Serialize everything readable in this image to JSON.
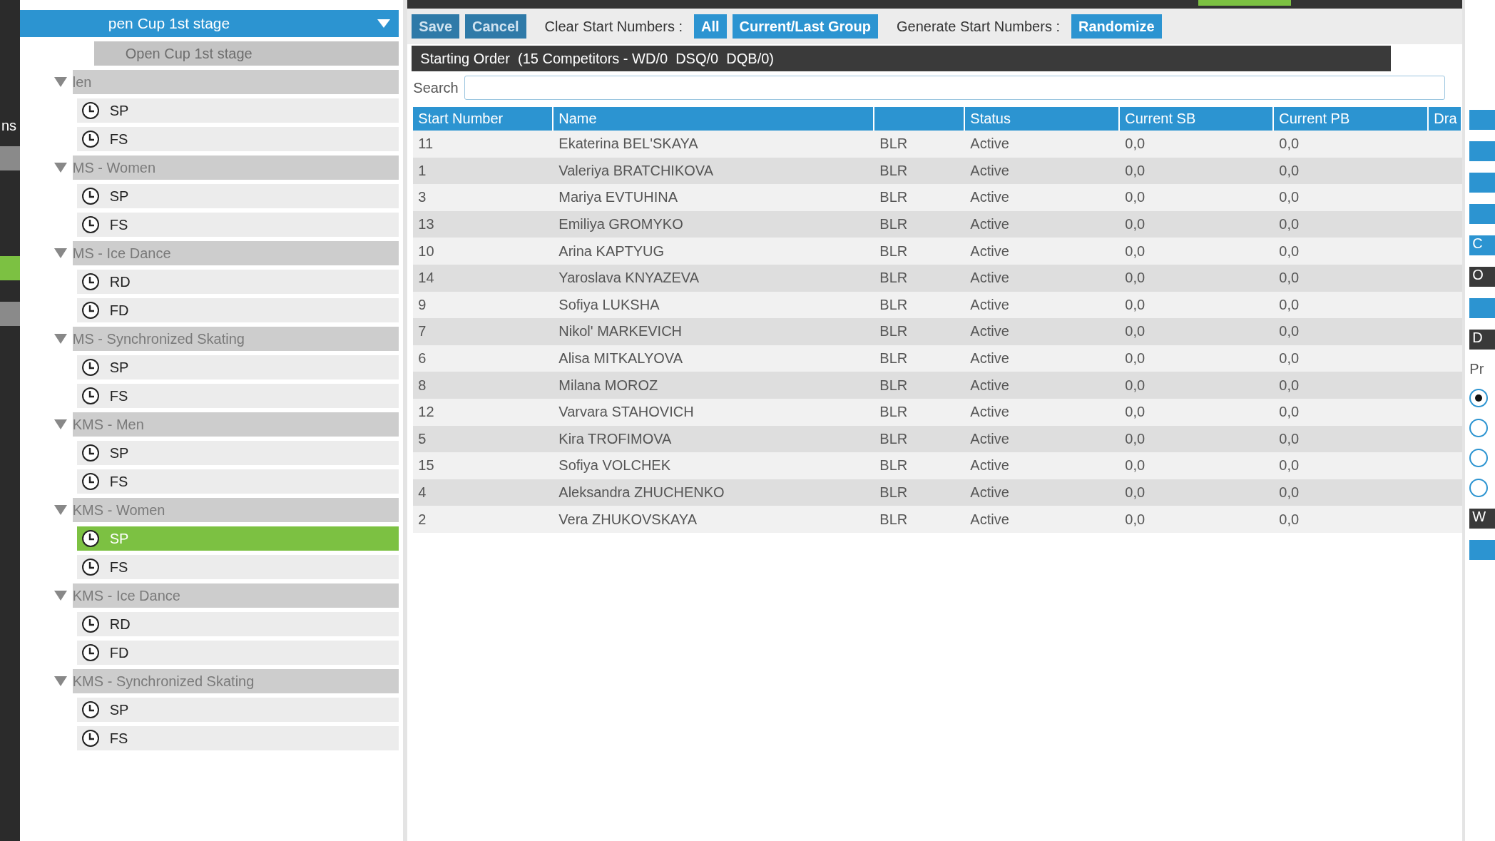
{
  "left_strip": {
    "label": "ns",
    "tabs": [
      {
        "selected": false
      },
      {
        "selected": true
      },
      {
        "selected": false
      }
    ]
  },
  "event_selector": {
    "value": "pen Cup 1st stage"
  },
  "tree": {
    "root": "Open Cup 1st stage",
    "groups": [
      {
        "label": "len",
        "expanded": true,
        "children": [
          {
            "label": "SP",
            "selected": false
          },
          {
            "label": "FS",
            "selected": false
          }
        ]
      },
      {
        "label": "MS - Women",
        "expanded": true,
        "children": [
          {
            "label": "SP",
            "selected": false
          },
          {
            "label": "FS",
            "selected": false
          }
        ]
      },
      {
        "label": "MS - Ice Dance",
        "expanded": true,
        "children": [
          {
            "label": "RD",
            "selected": false
          },
          {
            "label": "FD",
            "selected": false
          }
        ]
      },
      {
        "label": "MS - Synchronized Skating",
        "expanded": true,
        "children": [
          {
            "label": "SP",
            "selected": false
          },
          {
            "label": "FS",
            "selected": false
          }
        ]
      },
      {
        "label": "KMS - Men",
        "expanded": true,
        "children": [
          {
            "label": "SP",
            "selected": false
          },
          {
            "label": "FS",
            "selected": false
          }
        ]
      },
      {
        "label": "KMS - Women",
        "expanded": true,
        "children": [
          {
            "label": "SP",
            "selected": true
          },
          {
            "label": "FS",
            "selected": false
          }
        ]
      },
      {
        "label": "KMS - Ice Dance",
        "expanded": true,
        "children": [
          {
            "label": "RD",
            "selected": false
          },
          {
            "label": "FD",
            "selected": false
          }
        ]
      },
      {
        "label": "KMS - Synchronized Skating",
        "expanded": true,
        "children": [
          {
            "label": "SP",
            "selected": false
          },
          {
            "label": "FS",
            "selected": false
          }
        ]
      }
    ]
  },
  "toolbar": {
    "save": "Save",
    "cancel": "Cancel",
    "clear_label": "Clear Start Numbers :",
    "clear_all": "All",
    "clear_group": "Current/Last Group",
    "generate_label": "Generate Start Numbers :",
    "randomize": "Randomize"
  },
  "panel": {
    "title": "Starting Order  (15 Competitors - WD/0  DSQ/0  DQB/0)"
  },
  "search": {
    "label": "Search"
  },
  "table": {
    "columns": [
      "Start Number",
      "Name",
      "",
      "Status",
      "Current SB",
      "Current PB",
      "Dra"
    ],
    "rows": [
      [
        "11",
        "Ekaterina BEL'SKAYA",
        "BLR",
        "Active",
        "0,0",
        "0,0"
      ],
      [
        "1",
        "Valeriya BRATCHIKOVA",
        "BLR",
        "Active",
        "0,0",
        "0,0"
      ],
      [
        "3",
        "Mariya EVTUHINA",
        "BLR",
        "Active",
        "0,0",
        "0,0"
      ],
      [
        "13",
        "Emiliya GROMYKO",
        "BLR",
        "Active",
        "0,0",
        "0,0"
      ],
      [
        "10",
        "Arina KAPTYUG",
        "BLR",
        "Active",
        "0,0",
        "0,0"
      ],
      [
        "14",
        "Yaroslava KNYAZEVA",
        "BLR",
        "Active",
        "0,0",
        "0,0"
      ],
      [
        "9",
        "Sofiya LUKSHA",
        "BLR",
        "Active",
        "0,0",
        "0,0"
      ],
      [
        "7",
        "Nikol' MARKEVICH",
        "BLR",
        "Active",
        "0,0",
        "0,0"
      ],
      [
        "6",
        "Alisa MITKALYOVA",
        "BLR",
        "Active",
        "0,0",
        "0,0"
      ],
      [
        "8",
        "Milana MOROZ",
        "BLR",
        "Active",
        "0,0",
        "0,0"
      ],
      [
        "12",
        "Varvara STAHOVICH",
        "BLR",
        "Active",
        "0,0",
        "0,0"
      ],
      [
        "5",
        "Kira TROFIMOVA",
        "BLR",
        "Active",
        "0,0",
        "0,0"
      ],
      [
        "15",
        "Sofiya VOLCHEK",
        "BLR",
        "Active",
        "0,0",
        "0,0"
      ],
      [
        "4",
        "Aleksandra ZHUCHENKO",
        "BLR",
        "Active",
        "0,0",
        "0,0"
      ],
      [
        "2",
        "Vera ZHUKOVSKAYA",
        "BLR",
        "Active",
        "0,0",
        "0,0"
      ]
    ]
  },
  "right_panel": [
    {
      "kind": "button"
    },
    {
      "kind": "button"
    },
    {
      "kind": "button"
    },
    {
      "kind": "button"
    },
    {
      "kind": "button",
      "label": "C"
    },
    {
      "kind": "header",
      "label": "O"
    },
    {
      "kind": "button"
    },
    {
      "kind": "header",
      "label": "D"
    },
    {
      "kind": "text",
      "label": "Pr"
    },
    {
      "kind": "radio",
      "selected": true
    },
    {
      "kind": "radio",
      "selected": false
    },
    {
      "kind": "radio",
      "selected": false
    },
    {
      "kind": "radio",
      "selected": false
    },
    {
      "kind": "header",
      "label": "W"
    },
    {
      "kind": "button"
    }
  ]
}
